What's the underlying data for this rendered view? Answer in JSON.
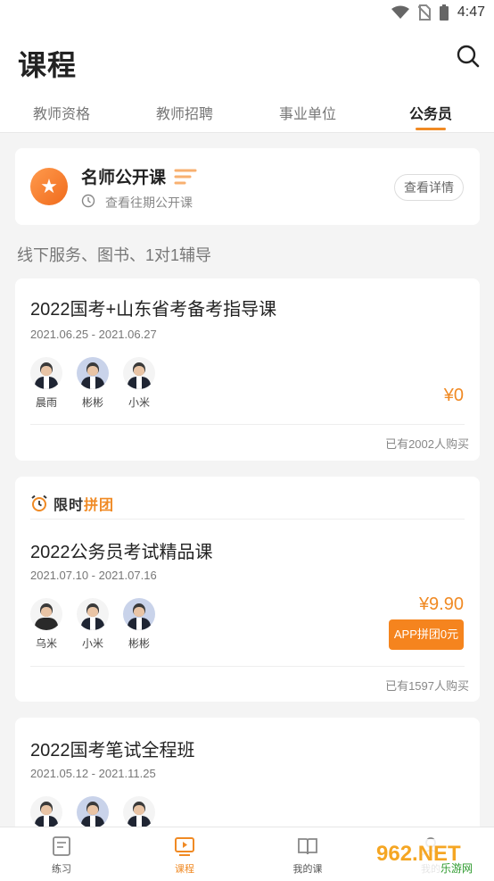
{
  "status_bar": {
    "time": "4:47"
  },
  "header": {
    "title": "课程",
    "tabs": [
      {
        "label": "教师资格"
      },
      {
        "label": "教师招聘"
      },
      {
        "label": "事业单位"
      },
      {
        "label": "公务员"
      }
    ],
    "active_tab": "公务员"
  },
  "open_class": {
    "title": "名师公开课",
    "subtitle": "查看往期公开课",
    "detail_button": "查看详情"
  },
  "section_title": "线下服务、图书、1对1辅导",
  "courses": [
    {
      "title": "2022国考+山东省考备考指导课",
      "date": "2021.06.25 - 2021.06.27",
      "teachers": [
        {
          "name": "晨雨"
        },
        {
          "name": "彬彬"
        },
        {
          "name": "小米"
        }
      ],
      "price": "¥0",
      "sold": "已有2002人购买"
    },
    {
      "badge": {
        "prefix": "限时",
        "highlight": "拼团"
      },
      "title": "2022公务员考试精品课",
      "date": "2021.07.10 - 2021.07.16",
      "teachers": [
        {
          "name": "乌米"
        },
        {
          "name": "小米"
        },
        {
          "name": "彬彬"
        }
      ],
      "price": "¥9.90",
      "group_button": "APP拼团0元",
      "sold": "已有1597人购买"
    },
    {
      "title": "2022国考笔试全程班",
      "date": "2021.05.12 - 2021.11.25"
    }
  ],
  "bottom_nav": [
    {
      "label": "练习",
      "icon": "practice-icon"
    },
    {
      "label": "课程",
      "icon": "course-play-icon"
    },
    {
      "label": "我的课",
      "icon": "my-course-icon"
    },
    {
      "label": "我的",
      "icon": "profile-icon"
    }
  ],
  "watermark": {
    "text": "962.NET",
    "sub": "乐游网"
  },
  "colors": {
    "accent": "#f08a24",
    "button": "#f5841e"
  }
}
